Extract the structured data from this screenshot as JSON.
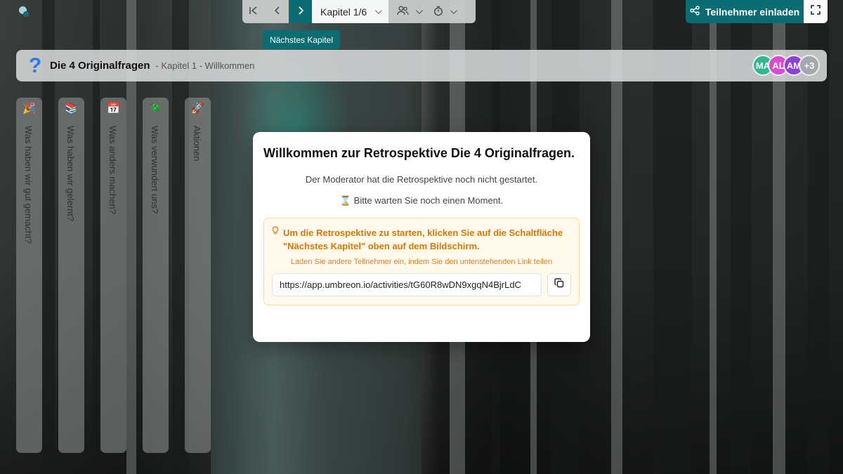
{
  "nav": {
    "chapter_label": "Kapitel 1/6",
    "tooltip": "Nächstes Kapitel",
    "icons": [
      "skip-to-start-icon",
      "previous-icon",
      "next-icon",
      "participants-icon",
      "timer-icon"
    ]
  },
  "actions": {
    "invite_label": "Teilnehmer einladen",
    "fullscreen_icon": "fullscreen-icon"
  },
  "header": {
    "title": "Die 4 Originalfragen",
    "subtitle": "- Kapitel 1 - Willkommen",
    "avatars": [
      {
        "initials": "MA",
        "color": "#2fb88e"
      },
      {
        "initials": "AL",
        "color": "#d84bd2"
      },
      {
        "initials": "AM",
        "color": "#8e3fe0"
      },
      {
        "initials": "+3",
        "color": "#a3a8ad"
      }
    ]
  },
  "columns": [
    {
      "emoji": "🎉",
      "label": "Was haben wir gut gemacht?"
    },
    {
      "emoji": "📚",
      "label": "Was haben wir gelernt?"
    },
    {
      "emoji": "📅",
      "label": "Was anders machen?"
    },
    {
      "emoji": "🪲",
      "label": "Was verwundert uns?"
    },
    {
      "emoji": "🚀",
      "label": "Aktionen"
    }
  ],
  "modal": {
    "title": "Willkommen zur Retrospektive Die 4 Originalfragen.",
    "status": "Der Moderator hat die Retrospektive noch nicht gestartet.",
    "wait": "⌛ Bitte warten Sie noch einen Moment.",
    "hint": "Um die Retrospektive zu starten, klicken Sie auf die Schaltfläche \"Nächstes Kapitel\" oben auf dem Bildschirm.",
    "invite_hint": "Laden Sie andere Teilnehmer ein, indem Sie den untenstehenden Link teilen",
    "link": "https://app.umbreon.io/activities/tG60R8wDN9xgqN4BjrLdC"
  },
  "colors": {
    "accent": "#0b6c72",
    "hint_text": "#d97706",
    "hint_bg": "#fffaeb"
  }
}
